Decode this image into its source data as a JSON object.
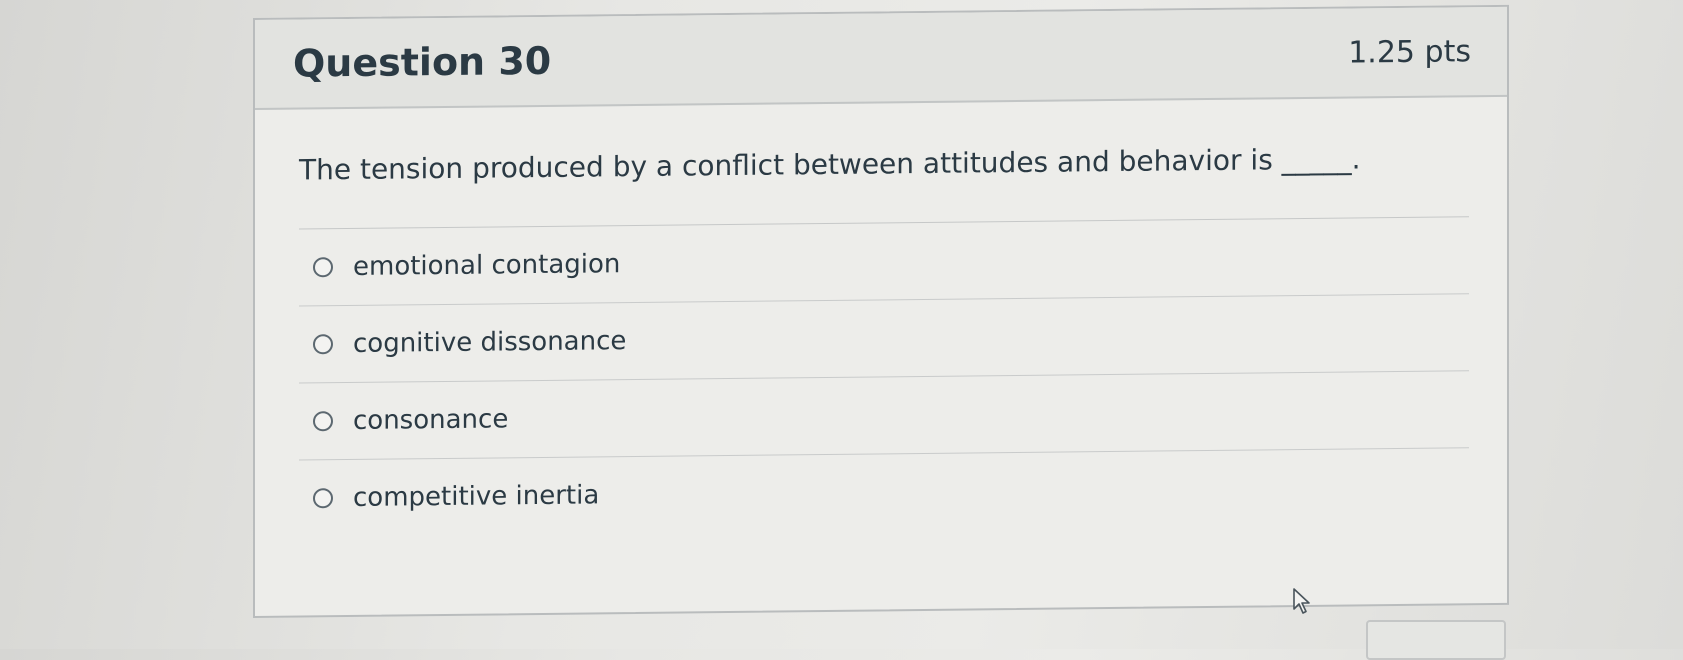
{
  "question": {
    "title": "Question 30",
    "points": "1.25 pts",
    "text": "The tension produced by a conflict between attitudes and behavior is _____.",
    "answers": [
      {
        "label": "emotional contagion"
      },
      {
        "label": "cognitive dissonance"
      },
      {
        "label": "consonance"
      },
      {
        "label": "competitive inertia"
      }
    ]
  },
  "icons": {
    "radio": "radio-empty-icon",
    "cursor": "mouse-pointer-icon"
  },
  "colors": {
    "text": "#2b3a44",
    "header_bg": "#e2e3e0",
    "border": "#b9bcbd"
  }
}
